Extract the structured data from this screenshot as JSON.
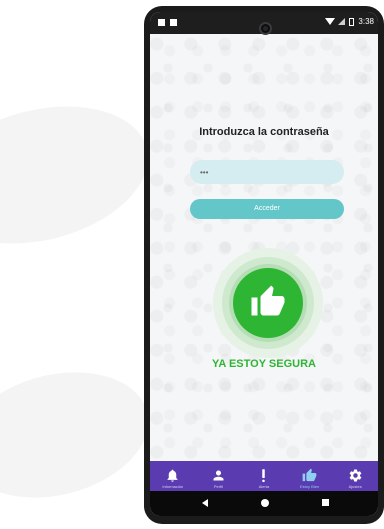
{
  "status_bar": {
    "time": "3:38",
    "icons": [
      "notification-square-icon",
      "notification-square-icon",
      "wifi-icon",
      "signal-icon",
      "battery-icon"
    ]
  },
  "login": {
    "title": "Introduzca la contraseña",
    "password_value": "•••",
    "button_label": "Acceder"
  },
  "safe_action": {
    "icon": "thumbs-up-icon",
    "label": "YA ESTOY SEGURA"
  },
  "bottom_nav": {
    "items": [
      {
        "label": "Información",
        "icon": "bell-icon",
        "active": false
      },
      {
        "label": "Perfil",
        "icon": "user-icon",
        "active": false
      },
      {
        "label": "Alerta",
        "icon": "exclamation-icon",
        "active": false
      },
      {
        "label": "Estoy Bien",
        "icon": "thumbs-up-icon",
        "active": true
      },
      {
        "label": "Ajustes",
        "icon": "gear-icon",
        "active": false
      }
    ]
  },
  "system_nav": {
    "icons": [
      "back-icon",
      "home-icon",
      "recents-icon"
    ]
  },
  "colors": {
    "nav_bar": "#5b3bb0",
    "primary_button": "#63c6c9",
    "password_field": "#d5ecf0",
    "safe_green": "#2eb534",
    "active_nav_label": "#8fd0f0"
  }
}
